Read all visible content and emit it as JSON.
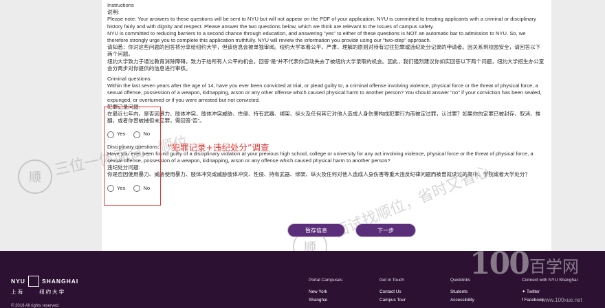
{
  "instructions": {
    "title": "Instructions",
    "title_cn": "说明:",
    "p1": "Please note: Your answers to these questions will be sent to NYU but will not appear on the PDF of your application. NYU is committed to treating applicants with a criminal or disciplinary history fairly and with dignity and respect. Please answer the two questions below, which we think are relevant to the issues of campus safety.",
    "p2": "NYU is committed to reducing barriers to a second chance through education, and answering \"yes\" to either of these questions is NOT an automatic bar to admission to NYU. So, we therefore strongly urge you to complete this application truthfully. NYU will review the information you provide using our \"two-step\" approach.",
    "p3_cn": "请知悉：你对这些问题的回答将分享给纽约大学，但该信息会被单独审阅。纽约大学本着公平、严肃、理解的原则对待有过往犯罪或违纪处分记录的申请者。因关系到校园安全，请回答以下两个问题。",
    "p4_cn": "纽约大学致力于通过教育消除障碍，致力于给所有人公平的机会。回答“是”并不代表你自动失去了被纽约大学录取的机会。因此，我们强烈建议你如实回答以下两个问题，纽约大学招生办公室会分两步对你提供的信息进行审核。"
  },
  "criminal": {
    "heading": "Criminal questions:",
    "question_en": "Within the last seven years after the age of 14, have you ever been convicted at trial, or plead guilty to, a criminal offense involving violence, physical force or the threat of physical force, a sexual offense, possession of a weapon, kidnapping, arson or any other offense which caused physical harm to another person? You should answer \"no\" if your conviction has been sealed, expunged, or overturned or if you were arrested but not convicted.",
    "heading_cn": "犯罪记录问题:",
    "question_cn": "在最近七年内，是否因暴力、肢体冲突、肢体冲突威胁、性侵、持有武器、绑架、纵火及任何其它对他人造成人身伤害构成犯罪行为而被定过罪，认过罪？如果你的定罪已被封存、取消、推翻，或者你曾被捕但未定罪，需回答“否”。",
    "yes_label": "Yes",
    "no_label": "No"
  },
  "disciplinary": {
    "heading": "Disciplinary questions:",
    "question_en": "Have you ever been found guilty of a disciplinary violation at your previous high school, college or university for any act involving violence, physical force or the threat of physical force, a sexual offense, possession of a weapon, kidnapping, arson or any offense which caused physical harm to another person?",
    "heading_cn": "违纪处分问题:",
    "question_cn": "你是否因使用暴力、威胁使用暴力、肢体冲突或威胁肢体冲突、性侵、持有武器、绑架、纵火及任何对他人造成人身伤害等重大违反纪律问题而被曾就读过的高中、学院或者大学处分？",
    "yes_label": "Yes",
    "no_label": "No"
  },
  "annotation": {
    "callout": "“犯罪记录+违纪处分”调查",
    "color": "#e3342f"
  },
  "buttons": {
    "save": "暂存信息",
    "next": "下一步"
  },
  "watermarks": {
    "left": "三位一体面试，顺位",
    "right": "面试找顺位，省时又省心",
    "seal_char": "顺",
    "brand_num": "100",
    "brand_cn": "百学网",
    "site": "www.100xue.net"
  },
  "footer": {
    "logo_en_left": "NYU",
    "logo_en_right": "SHANGHAI",
    "logo_cn_left": "上海",
    "logo_cn_right": "纽约大学",
    "copyright": "© 2018 All rights reserved.",
    "columns": [
      {
        "heading": "Portal Campuses",
        "items": [
          "New York",
          "Shanghai"
        ]
      },
      {
        "heading": "Get in Touch",
        "items": [
          "Contact Us",
          "Campus Tour"
        ]
      },
      {
        "heading": "Quicklinks",
        "items": [
          "Students",
          "Accessibility"
        ]
      },
      {
        "heading": "Connect with NYU Shanghai",
        "items": [
          "Twitter",
          "Facebook"
        ]
      }
    ],
    "bg_color": "#2c1133"
  }
}
